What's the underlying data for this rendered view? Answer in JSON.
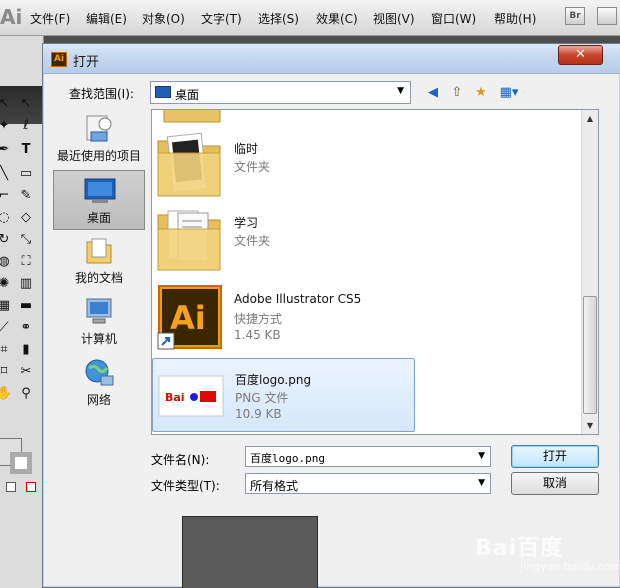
{
  "app": {
    "logo": "Ai",
    "menu": [
      "文件(F)",
      "编辑(E)",
      "对象(O)",
      "文字(T)",
      "选择(S)",
      "效果(C)",
      "视图(V)",
      "窗口(W)",
      "帮助(H)"
    ],
    "bridge_button": "Br"
  },
  "dialog": {
    "title": "打开",
    "close": "✕",
    "lookin_label": "查找范围(I):",
    "lookin_value": "桌面",
    "places": [
      {
        "label": "最近使用的项目",
        "icon": "recent-icon"
      },
      {
        "label": "桌面",
        "icon": "desktop-icon"
      },
      {
        "label": "我的文档",
        "icon": "documents-icon"
      },
      {
        "label": "计算机",
        "icon": "computer-icon"
      },
      {
        "label": "网络",
        "icon": "network-icon"
      }
    ],
    "files": [
      {
        "name": "临时",
        "type": "文件夹",
        "size": ""
      },
      {
        "name": "学习",
        "type": "文件夹",
        "size": ""
      },
      {
        "name": "Adobe Illustrator CS5",
        "type": "快捷方式",
        "size": "1.45 KB"
      },
      {
        "name": "百度logo.png",
        "type": "PNG 文件",
        "size": "10.9 KB"
      }
    ],
    "filename_label": "文件名(N):",
    "filename_value": "百度logo.png",
    "filetype_label": "文件类型(T):",
    "filetype_value": "所有格式",
    "open_button": "打开",
    "cancel_button": "取消"
  },
  "watermark": {
    "text": "Bai百度",
    "sub": "jingyan.baidu.com"
  }
}
